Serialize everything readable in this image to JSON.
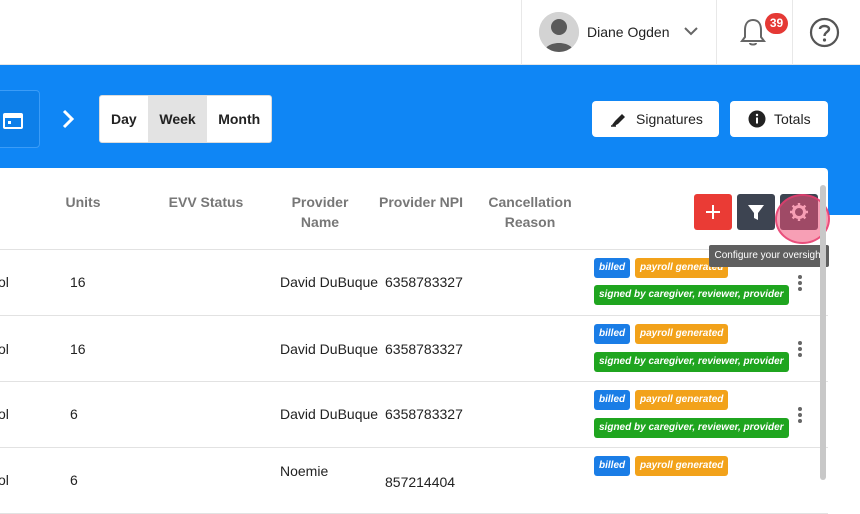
{
  "header": {
    "user_name": "Diane Ogden",
    "notification_count": "39"
  },
  "toolbar": {
    "views": [
      "Day",
      "Week",
      "Month"
    ],
    "selected_view": "Week",
    "signatures_label": "Signatures",
    "totals_label": "Totals"
  },
  "table": {
    "columns": {
      "units": "Units",
      "evv_status": "EVV Status",
      "provider_name": "Provider Name",
      "provider_npi": "Provider NPI",
      "cancellation_reason": "Cancellation Reason"
    },
    "rows": [
      {
        "col0": "ol",
        "units": "16",
        "provider_name": "David DuBuque",
        "provider_npi": "6358783327",
        "tags": [
          "billed",
          "payroll generated",
          "signed by caregiver, reviewer, provider"
        ]
      },
      {
        "col0": "ol",
        "units": "16",
        "provider_name": "David DuBuque",
        "provider_npi": "6358783327",
        "tags": [
          "billed",
          "payroll generated",
          "signed by caregiver, reviewer, provider"
        ]
      },
      {
        "col0": "ol",
        "units": "6",
        "provider_name": "David DuBuque",
        "provider_npi": "6358783327",
        "tags": [
          "billed",
          "payroll generated",
          "signed by caregiver, reviewer, provider"
        ]
      },
      {
        "col0": "ol",
        "units": "6",
        "provider_name": "Noemie",
        "provider_npi": "857214404",
        "tags": [
          "billed",
          "payroll generated"
        ]
      }
    ]
  },
  "tooltip": "Configure your oversight",
  "icons": {
    "add": "plus-icon",
    "filter": "filter-icon",
    "settings": "gear-icon",
    "calendar": "calendar-icon",
    "next": "chevron-right-icon"
  },
  "colors": {
    "band": "#0f86f5",
    "add_button": "#ea3b35",
    "dark_button": "#3d4451",
    "billed": "#1a7de6",
    "payroll": "#f2a21a",
    "signed": "#1fa51f",
    "badge": "#e53935"
  }
}
